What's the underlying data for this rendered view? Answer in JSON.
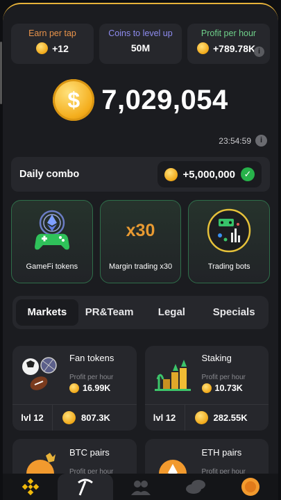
{
  "stats": [
    {
      "label": "Earn per tap",
      "value": "+12",
      "label_color": "#e8934a",
      "has_coin": true,
      "has_info": false
    },
    {
      "label": "Coins to level up",
      "value": "50M",
      "label_color": "#8e8cf0",
      "has_coin": false,
      "has_info": false
    },
    {
      "label": "Profit per hour",
      "value": "+789.78K",
      "label_color": "#6fd08a",
      "has_coin": true,
      "has_info": true
    }
  ],
  "balance": {
    "amount": "7,029,054",
    "coin_symbol": "$"
  },
  "timer": {
    "value": "23:54:59",
    "info_symbol": "i"
  },
  "daily_combo": {
    "label": "Daily combo",
    "reward": "+5,000,000",
    "check_symbol": "✓"
  },
  "features": [
    {
      "label": "GameFi tokens",
      "icon": "gamepad-icon"
    },
    {
      "label": "Margin trading x30",
      "icon_text": "x30"
    },
    {
      "label": "Trading bots",
      "icon": "trading-bot-icon"
    }
  ],
  "tabs": [
    {
      "label": "Markets",
      "active": true
    },
    {
      "label": "PR&Team",
      "active": false
    },
    {
      "label": "Legal",
      "active": false
    },
    {
      "label": "Specials",
      "active": false
    }
  ],
  "cards": [
    {
      "name": "Fan tokens",
      "pph_label": "Profit per hour",
      "pph_value": "16.99K",
      "level": "lvl 12",
      "cost": "807.3K",
      "icon": "sport-balls-icon"
    },
    {
      "name": "Staking",
      "pph_label": "Profit per hour",
      "pph_value": "10.73K",
      "level": "lvl 12",
      "cost": "282.55K",
      "icon": "staking-icon"
    }
  ],
  "cards_partial": [
    {
      "name": "BTC pairs",
      "pph_label": "Profit per hour",
      "icon": "btc-coin-icon"
    },
    {
      "name": "ETH pairs",
      "pph_label": "Profit per hour",
      "icon": "eth-coin-icon"
    }
  ],
  "nav": [
    {
      "icon": "binance-icon",
      "active": false
    },
    {
      "icon": "pickaxe-icon",
      "active": true
    },
    {
      "icon": "friends-icon",
      "active": false
    },
    {
      "icon": "coins-stack-icon",
      "active": false
    },
    {
      "icon": "airdrop-coin-icon",
      "active": false
    }
  ],
  "colors": {
    "accent": "#e8b33a",
    "green": "#27b24a",
    "card_bg": "#26272c",
    "page_bg": "#1b1c20"
  }
}
